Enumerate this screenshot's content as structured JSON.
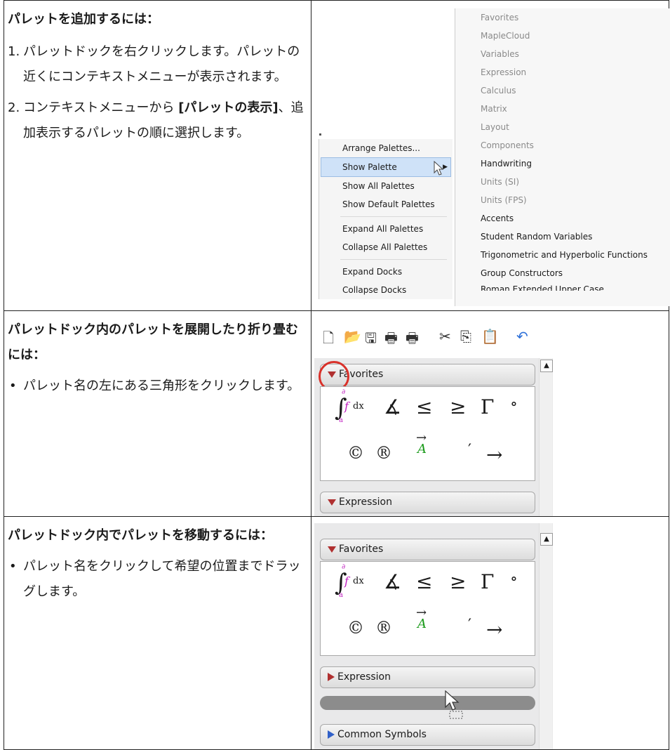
{
  "rows": [
    {
      "heading": "パレットを追加するには：",
      "items": [
        {
          "marker": "1.",
          "text": "パレットドックを右クリックします。パレットの近くにコンテキストメニューが表示されます。"
        },
        {
          "marker": "2.",
          "pre": "コンテキストメニューから ",
          "bold": "[パレットの表示]",
          "post": "、追加表示するパレットの順に選択します。"
        }
      ]
    },
    {
      "heading": "パレットドック内のパレットを展開したり折り畳むには：",
      "items": [
        {
          "marker": "•",
          "text": "パレット名の左にある三角形をクリックします。"
        }
      ]
    },
    {
      "heading": "パレットドック内でパレットを移動するには：",
      "items": [
        {
          "marker": "•",
          "text": "パレット名をクリックして希望の位置までドラッグします。"
        }
      ]
    }
  ],
  "context_menu": {
    "groups": [
      [
        "Arrange Palettes...",
        "Show Palette",
        "Show All Palettes",
        "Show Default Palettes"
      ],
      [
        "Expand All Palettes",
        "Collapse All Palettes"
      ],
      [
        "Expand Docks",
        "Collapse Docks"
      ]
    ]
  },
  "submenu": {
    "items": [
      {
        "label": "Favorites",
        "enabled": false
      },
      {
        "label": "MapleCloud",
        "enabled": false
      },
      {
        "label": "Variables",
        "enabled": false
      },
      {
        "label": "Expression",
        "enabled": false
      },
      {
        "label": "Calculus",
        "enabled": false
      },
      {
        "label": "Matrix",
        "enabled": false
      },
      {
        "label": "Layout",
        "enabled": false
      },
      {
        "label": "Components",
        "enabled": false
      },
      {
        "label": "Handwriting",
        "enabled": true
      },
      {
        "label": "Units (SI)",
        "enabled": false
      },
      {
        "label": "Units (FPS)",
        "enabled": false
      },
      {
        "label": "Accents",
        "enabled": true
      },
      {
        "label": "Student Random Variables",
        "enabled": true
      },
      {
        "label": "Trigonometric and Hyperbolic Functions",
        "enabled": true
      },
      {
        "label": "Group Constructors",
        "enabled": true
      },
      {
        "label": "Roman Extended Upper Case",
        "enabled": true
      }
    ]
  },
  "palettes": {
    "favorites": "Favorites",
    "expression": "Expression",
    "common_symbols": "Common Symbols",
    "symbols": {
      "integral_upper": "∂",
      "integral_f": "f",
      "integral_d": "dx",
      "integral_lower": "a",
      "angle": "∡",
      "le": "≤",
      "ge": "≥",
      "gamma": "Γ",
      "ring": "∘",
      "copyright": "©",
      "registered": "®",
      "vec_arrow": "→",
      "vec_A": "A",
      "prime": "′",
      "arrow": "→"
    }
  },
  "toolbar_icons": [
    "new-icon",
    "open-icon",
    "save-icon",
    "print-icon",
    "print-preview-icon",
    "cut-icon",
    "copy-icon",
    "paste-icon",
    "undo-icon"
  ],
  "colors": {
    "highlight_circle": "#d9312a",
    "collapse_triangle": "#b03030",
    "expand_blue_triangle": "#3060c8",
    "menu_selection": "#cfe2f8"
  }
}
